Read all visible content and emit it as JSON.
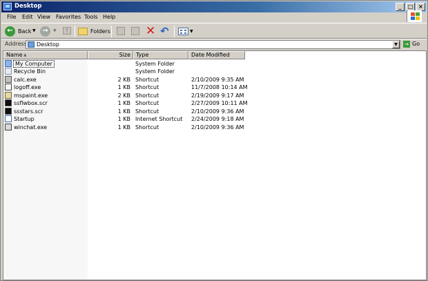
{
  "window": {
    "title": "Desktop"
  },
  "menu": [
    "File",
    "Edit",
    "View",
    "Favorites",
    "Tools",
    "Help"
  ],
  "toolbar": {
    "back_label": "Back",
    "folders_label": "Folders"
  },
  "address": {
    "label": "Address",
    "value": "Desktop",
    "go_label": "Go"
  },
  "columns": {
    "name": "Name",
    "size": "Size",
    "type": "Type",
    "date": "Date Modified"
  },
  "files": [
    {
      "name": "My Computer",
      "size": "",
      "type": "System Folder",
      "date": "",
      "icon": "my-computer-icon"
    },
    {
      "name": "Recycle Bin",
      "size": "",
      "type": "System Folder",
      "date": "",
      "icon": "recycle-bin-icon"
    },
    {
      "name": "calc.exe",
      "size": "2 KB",
      "type": "Shortcut",
      "date": "2/10/2009 9:35 AM",
      "icon": "calc-icon"
    },
    {
      "name": "logoff.exe",
      "size": "1 KB",
      "type": "Shortcut",
      "date": "11/7/2008 10:14 AM",
      "icon": "program-icon"
    },
    {
      "name": "mspaint.exe",
      "size": "2 KB",
      "type": "Shortcut",
      "date": "2/19/2009 9:17 AM",
      "icon": "paint-icon"
    },
    {
      "name": "ssflwbox.scr",
      "size": "1 KB",
      "type": "Shortcut",
      "date": "2/27/2009 10:11 AM",
      "icon": "screensaver-icon"
    },
    {
      "name": "ssstars.scr",
      "size": "1 KB",
      "type": "Shortcut",
      "date": "2/10/2009 9:36 AM",
      "icon": "screensaver-icon"
    },
    {
      "name": "Startup",
      "size": "1 KB",
      "type": "Internet Shortcut",
      "date": "2/24/2009 9:18 AM",
      "icon": "internet-shortcut-icon"
    },
    {
      "name": "winchat.exe",
      "size": "1 KB",
      "type": "Shortcut",
      "date": "2/10/2009 9:36 AM",
      "icon": "chat-icon"
    }
  ]
}
